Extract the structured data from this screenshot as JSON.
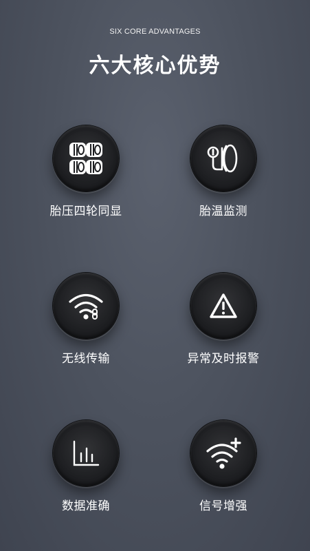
{
  "header": {
    "subtitle": "SIX CORE ADVANTAGES",
    "title": "六大核心优势"
  },
  "features": [
    {
      "label": "胎压四轮同显",
      "icon": "four-tires-icon"
    },
    {
      "label": "胎温监测",
      "icon": "tire-temperature-icon"
    },
    {
      "label": "无线传输",
      "icon": "wireless-link-icon"
    },
    {
      "label": "异常及时报警",
      "icon": "warning-triangle-icon"
    },
    {
      "label": "数据准确",
      "icon": "bar-chart-icon"
    },
    {
      "label": "信号增强",
      "icon": "wifi-plus-icon"
    }
  ],
  "colors": {
    "background": "#4d535f",
    "button": "#1d1e21",
    "icon": "#ffffff",
    "text": "#ffffff"
  }
}
